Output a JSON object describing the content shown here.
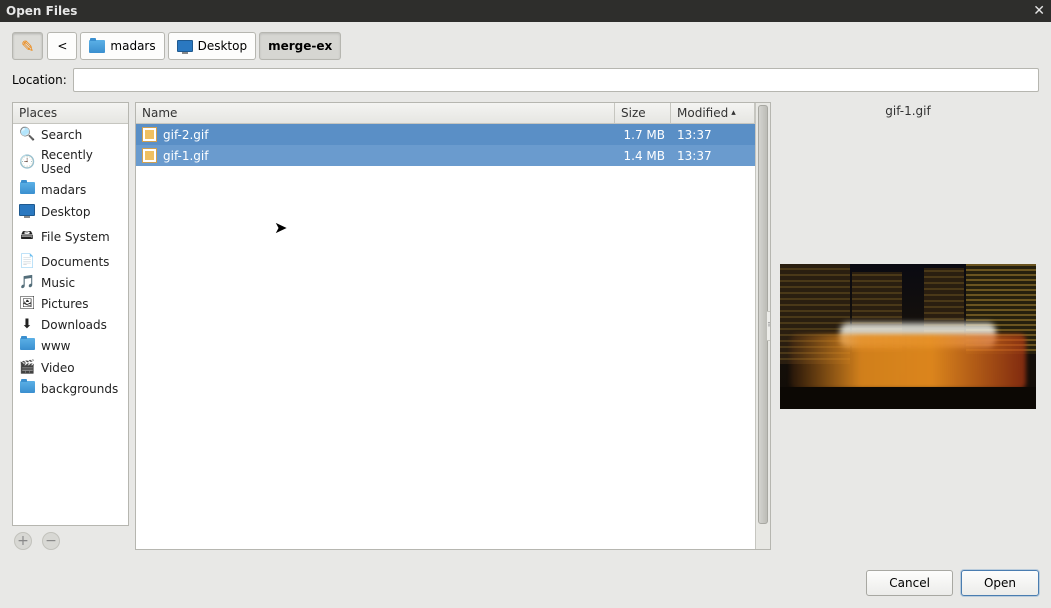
{
  "title": "Open Files",
  "breadcrumb": {
    "back_glyph": "<",
    "items": [
      {
        "label": "madars",
        "icon": "folder"
      },
      {
        "label": "Desktop",
        "icon": "desktop"
      },
      {
        "label": "merge-ex",
        "icon": null,
        "current": true
      }
    ]
  },
  "location": {
    "label": "Location:",
    "value": ""
  },
  "places": {
    "header": "Places",
    "items": [
      {
        "label": "Search",
        "icon": "🔍"
      },
      {
        "label": "Recently Used",
        "icon": "🕘"
      },
      {
        "label": "madars",
        "icon": "folder"
      },
      {
        "label": "Desktop",
        "icon": "desktop"
      },
      {
        "label": "File System",
        "icon": "🖴"
      },
      {
        "label": "Documents",
        "icon": "📄"
      },
      {
        "label": "Music",
        "icon": "🎵"
      },
      {
        "label": "Pictures",
        "icon": "🖼"
      },
      {
        "label": "Downloads",
        "icon": "⬇"
      },
      {
        "label": "www",
        "icon": "folder"
      },
      {
        "label": "Video",
        "icon": "🎬"
      },
      {
        "label": "backgrounds",
        "icon": "folder"
      }
    ]
  },
  "files": {
    "columns": {
      "name": "Name",
      "size": "Size",
      "modified": "Modified"
    },
    "rows": [
      {
        "name": "gif-2.gif",
        "size": "1.7 MB",
        "modified": "13:37",
        "selected": true
      },
      {
        "name": "gif-1.gif",
        "size": "1.4 MB",
        "modified": "13:37",
        "selected": true
      }
    ]
  },
  "preview": {
    "filename": "gif-1.gif"
  },
  "buttons": {
    "cancel": "Cancel",
    "open": "Open"
  }
}
